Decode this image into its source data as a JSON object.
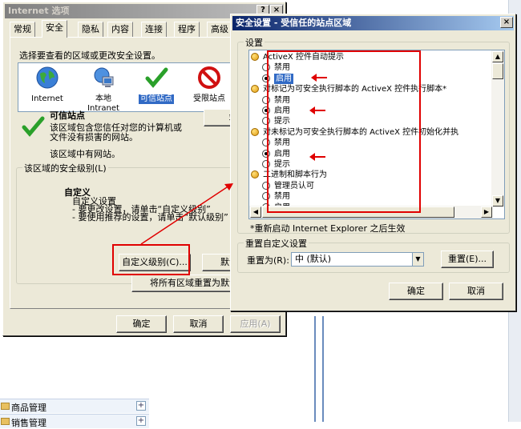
{
  "background": {
    "nav_items": [
      {
        "label": "商品管理",
        "expand": "+"
      },
      {
        "label": "销售管理",
        "expand": "+"
      }
    ]
  },
  "options_dialog": {
    "title": "Internet 选项",
    "title_buttons": {
      "help": "?",
      "close": "×"
    },
    "tabs": [
      "常规",
      "安全",
      "隐私",
      "内容",
      "连接",
      "程序",
      "高级"
    ],
    "selected_tab": "安全",
    "zone_prompt": "选择要查看的区域或更改安全设置。",
    "zones": [
      {
        "label": "Internet",
        "icon": "globe-icon"
      },
      {
        "label": "本地\nIntranet",
        "icon": "intranet-icon"
      },
      {
        "label": "可信站点",
        "icon": "checkmark-icon"
      },
      {
        "label": "受限站点",
        "icon": "restricted-icon"
      }
    ],
    "selected_zone": "可信站点",
    "zone_heading": "可信站点",
    "zone_desc": "该区域包含您信任对您的计算机或\n文件没有损害的网站。",
    "zone_desc2": "该区域中有网站。",
    "sites_button": "站点",
    "security_level_legend": "该区域的安全级别(L)",
    "custom_heading": "自定义",
    "custom_lines": [
      "自定义设置",
      "- 要更改设置，请单击“自定义级别”",
      "- 要使用推荐的设置，请单击“默认级别”"
    ],
    "custom_level_button": "自定义级别(C)...",
    "default_level_button": "默认级别",
    "reset_all_button": "将所有区域重置为默认级别",
    "ok_button": "确定",
    "cancel_button": "取消",
    "apply_button": "应用(A)"
  },
  "security_dialog": {
    "title": "安全设置 - 受信任的站点区域",
    "close_button": "×",
    "settings_legend": "设置",
    "settings_tree": [
      {
        "type": "heading",
        "label": "ActiveX 控件自动提示"
      },
      {
        "type": "option",
        "label": "禁用",
        "checked": false
      },
      {
        "type": "option",
        "label": "启用",
        "checked": true,
        "highlight": true
      },
      {
        "type": "heading",
        "label": "对标记为可安全执行脚本的 ActiveX 控件执行脚本*"
      },
      {
        "type": "option",
        "label": "禁用",
        "checked": false
      },
      {
        "type": "option",
        "label": "启用",
        "checked": true
      },
      {
        "type": "option",
        "label": "提示",
        "checked": false
      },
      {
        "type": "heading",
        "label": "对未标记为可安全执行脚本的 ActiveX 控件初始化并执"
      },
      {
        "type": "option",
        "label": "禁用",
        "checked": false
      },
      {
        "type": "option",
        "label": "启用",
        "checked": true
      },
      {
        "type": "option",
        "label": "提示",
        "checked": false
      },
      {
        "type": "heading",
        "label": "二进制和脚本行为"
      },
      {
        "type": "option",
        "label": "管理员认可",
        "checked": false
      },
      {
        "type": "option",
        "label": "禁用",
        "checked": false
      },
      {
        "type": "option",
        "label": "启用",
        "checked": false
      }
    ],
    "restart_note": "*重新启动 Internet Explorer 之后生效",
    "reset_legend": "重置自定义设置",
    "reset_to_label": "重置为(R):",
    "reset_to_value": "中 (默认)",
    "reset_button": "重置(E)...",
    "ok_button": "确定",
    "cancel_button": "取消"
  }
}
